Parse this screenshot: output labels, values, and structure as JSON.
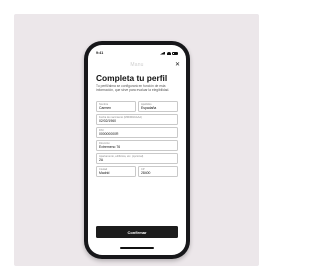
{
  "status": {
    "time": "9:41"
  },
  "app": {
    "brand": "Manu",
    "close_glyph": "✕"
  },
  "title": "Completa tu perfil",
  "description": "Tu perfil/alma se configurará en función de esta información, que sirve para evaluar la elegibilidad.",
  "fields": {
    "nombre": {
      "label": "Nombre",
      "value": "Carmen"
    },
    "apellidos": {
      "label": "Apellidos",
      "value": "Espadaña"
    },
    "nacimiento": {
      "label": "Fecha de nacimiento (MM/DD/AAAA)",
      "value": "02/02/1960"
    },
    "dni": {
      "label": "DNI",
      "value": "000000000R"
    },
    "direccion": {
      "label": "Dirección",
      "value": "Extremeno 76"
    },
    "piso": {
      "label": "Apartamento, edificio/a, etc. (opcional)",
      "value": "2A"
    },
    "ciudad": {
      "label": "Ciudad",
      "value": "Madrid"
    },
    "cp": {
      "label": "CP",
      "value": "28400"
    }
  },
  "actions": {
    "confirm_label": "Confirmar"
  }
}
